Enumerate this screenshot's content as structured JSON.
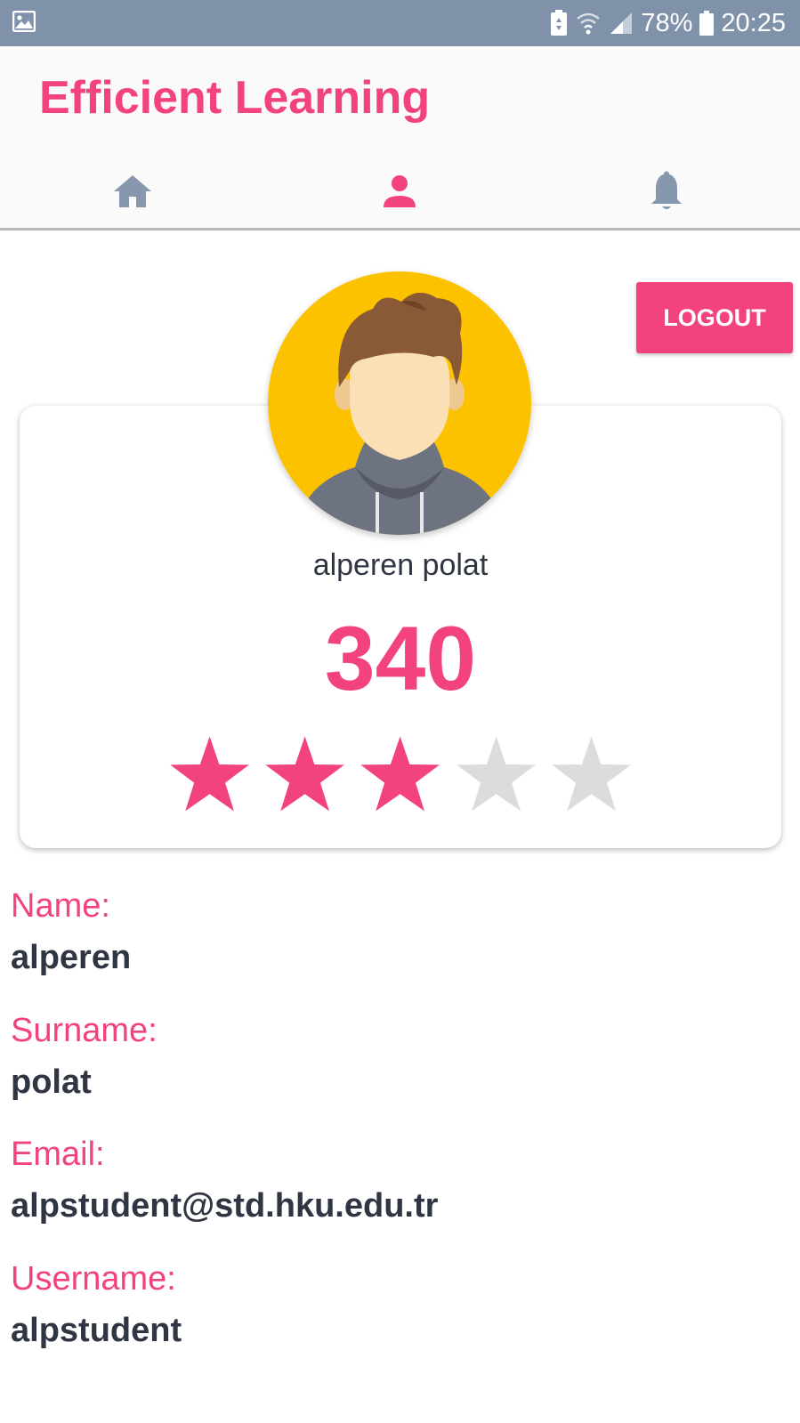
{
  "status_bar": {
    "icons": [
      "gallery-icon",
      "battery-saver-icon",
      "wifi-icon",
      "signal-icon",
      "battery-icon"
    ],
    "battery": "78%",
    "time": "20:25"
  },
  "header": {
    "title": "Efficient Learning",
    "tabs": [
      {
        "name": "home",
        "icon": "home-icon",
        "active": false
      },
      {
        "name": "profile",
        "icon": "person-icon",
        "active": true
      },
      {
        "name": "notifications",
        "icon": "bell-icon",
        "active": false
      }
    ]
  },
  "profile": {
    "logout_label": "LOGOUT",
    "full_name": "alperen polat",
    "score": "340",
    "rating": 3,
    "rating_max": 5
  },
  "fields": [
    {
      "label": "Name:",
      "value": "alperen"
    },
    {
      "label": "Surname:",
      "value": "polat"
    },
    {
      "label": "Email:",
      "value": "alpstudent@std.hku.edu.tr"
    },
    {
      "label": "Username:",
      "value": "alpstudent"
    }
  ],
  "colors": {
    "accent": "#f2437f",
    "status_bar": "#7f92aa",
    "inactive_icon": "#8797ad",
    "star_empty": "#dcdcdc",
    "avatar_bg": "#fcc200"
  }
}
